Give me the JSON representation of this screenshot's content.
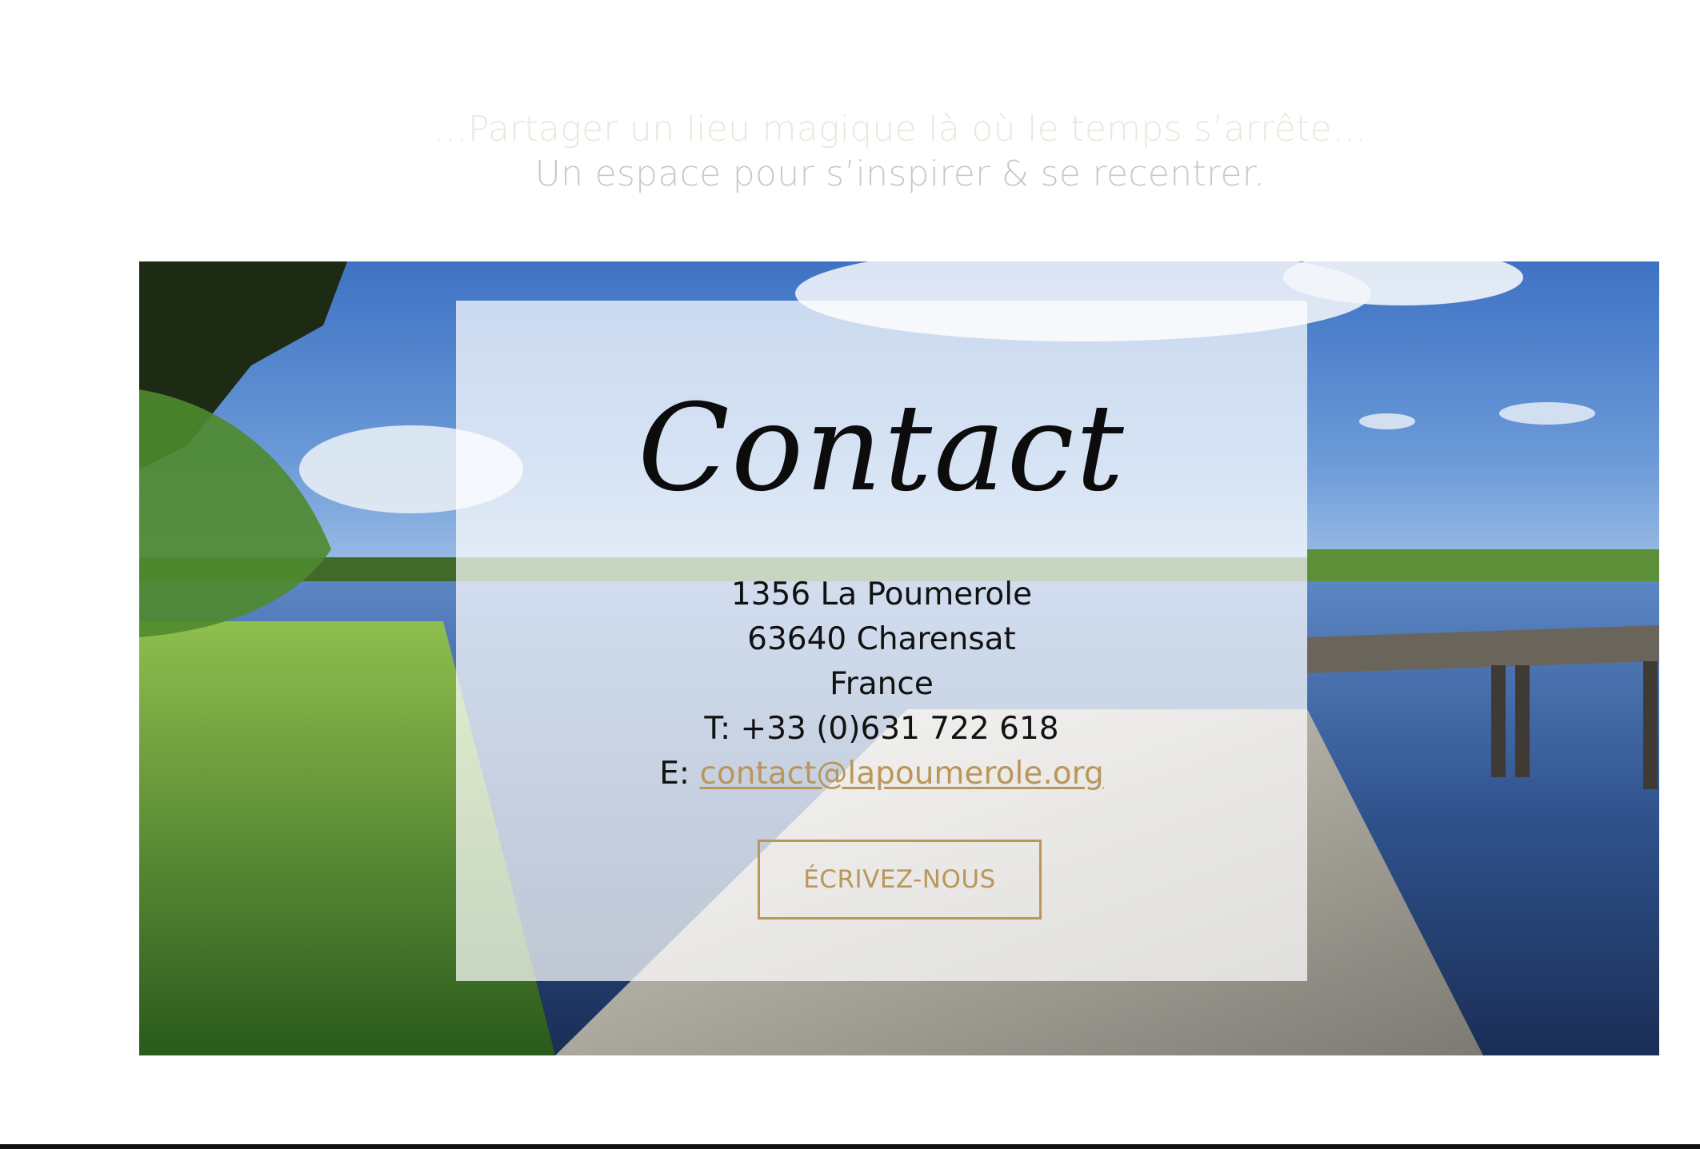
{
  "tagline": {
    "line1": "…Partager un lieu magique là où le temps s’arrête…",
    "line2": "Un espace pour s’inspirer & se recentrer."
  },
  "hero": {
    "image_description_icon": "lake-landscape-image"
  },
  "contact": {
    "title": "Contact",
    "address_line1": "1356 La Poumerole",
    "address_line2": "63640 Charensat",
    "country": "France",
    "phone_prefix": "T:",
    "phone": "+33 (0)631 722 618",
    "email_prefix": "E:",
    "email": "contact@lapoumerole.org",
    "button_label": "ÉCRIVEZ-NOUS"
  },
  "colors": {
    "accent": "#b9975b",
    "text": "#111111",
    "tagline_light": "#ece7dc",
    "tagline_grey": "#c9c9c9"
  }
}
